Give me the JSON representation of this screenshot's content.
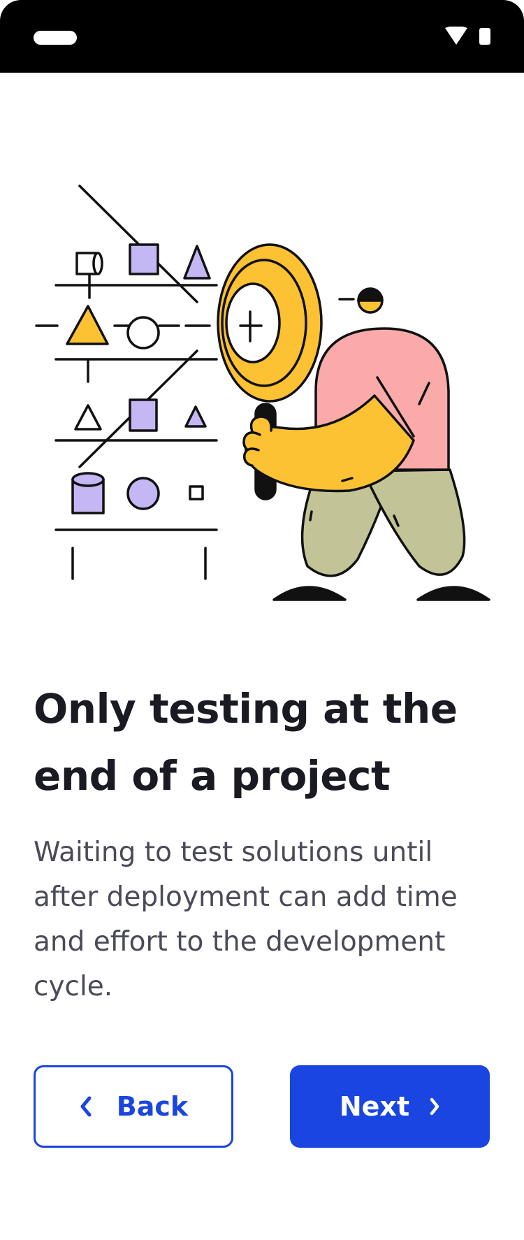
{
  "onboarding": {
    "title_line1": "Only testing at the",
    "title_line2": "end of a project",
    "body": "Waiting to test solutions until after deployment can add time and effort to the development cycle."
  },
  "buttons": {
    "back_label": "Back",
    "next_label": "Next"
  },
  "icons": {
    "back": "chevron-left-icon",
    "next": "chevron-right-icon",
    "wifi": "wifi-icon",
    "battery": "battery-icon"
  },
  "colors": {
    "primary": "#1a45e0",
    "title": "#1a1b22",
    "body": "#4a4b57",
    "yellow": "#fcc233",
    "purple": "#c5b6f4",
    "pink": "#fbaaaa",
    "olive": "#c2c497"
  }
}
